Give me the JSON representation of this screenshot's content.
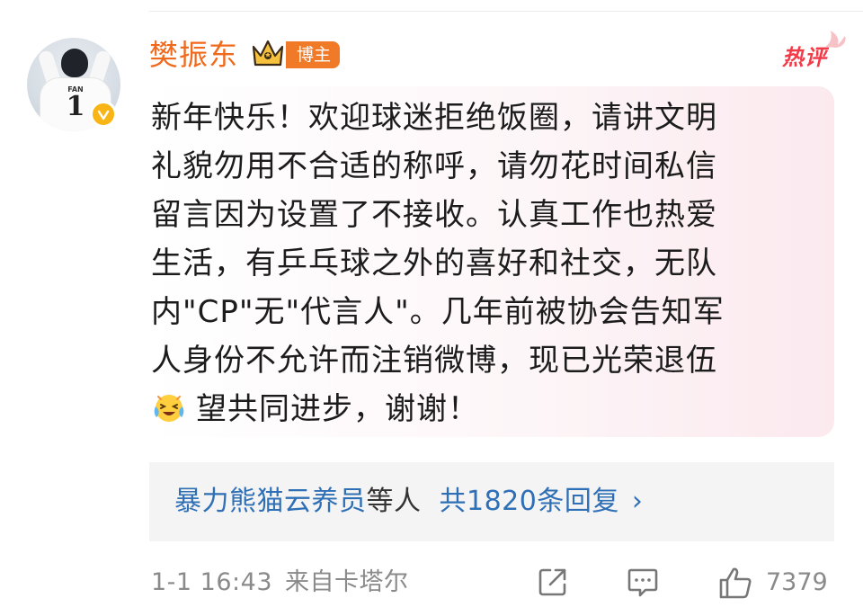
{
  "comment": {
    "username": "樊振东",
    "badge_label": "博主",
    "hot_tag": "热评",
    "text_lines": [
      "新年快乐！欢迎球迷拒绝饭圈，请讲文明",
      "礼貌勿用不合适的称呼，请勿花时间私信",
      "留言因为设置了不接收。认真工作也热爱",
      "生活，有乒乓球之外的喜好和社交，无队",
      "内\"CP\"无\"代言人\"。几年前被协会告知军",
      "人身份不允许而注销微博，现已光荣退伍"
    ],
    "last_line": "望共同进步，谢谢！",
    "avatar_jersey_name": "FAN",
    "avatar_jersey_number": "1"
  },
  "replies": {
    "users": "暴力熊猫云养员",
    "suffix": "等人",
    "count_text": "共1820条回复",
    "chevron": "›"
  },
  "meta": {
    "timestamp": "1-1 16:43",
    "source": "来自卡塔尔",
    "like_count": "7379"
  },
  "colors": {
    "username": "#f06a1d",
    "badge": "#f07a28",
    "hot_tag": "#f23b48",
    "link": "#2f6fb5",
    "verified": "#f8b515"
  }
}
